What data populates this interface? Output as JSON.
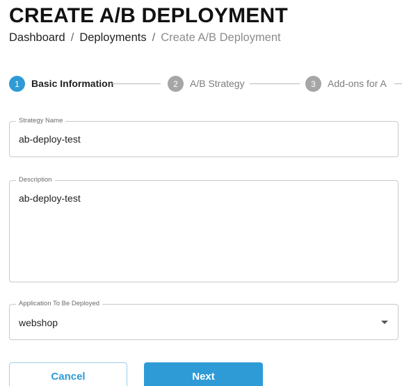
{
  "header": {
    "title": "CREATE A/B DEPLOYMENT"
  },
  "breadcrumb": {
    "items": [
      "Dashboard",
      "Deployments"
    ],
    "separator": "/",
    "current": "Create A/B Deployment"
  },
  "stepper": {
    "steps": [
      {
        "number": "1",
        "label": "Basic Information",
        "state": "active"
      },
      {
        "number": "2",
        "label": "A/B Strategy",
        "state": "inactive"
      },
      {
        "number": "3",
        "label": "Add-ons for A",
        "state": "inactive"
      }
    ]
  },
  "form": {
    "strategy_name": {
      "label": "Strategy Name",
      "value": "ab-deploy-test"
    },
    "description": {
      "label": "Description",
      "value": "ab-deploy-test"
    },
    "application": {
      "label": "Application To Be Deployed",
      "value": "webshop"
    }
  },
  "actions": {
    "cancel_label": "Cancel",
    "next_label": "Next"
  },
  "colors": {
    "accent": "#2e9bd6",
    "inactive_step": "#a6a6a6"
  }
}
